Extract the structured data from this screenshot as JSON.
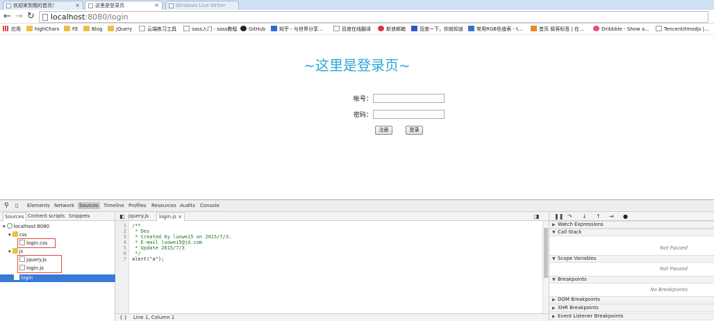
{
  "browser": {
    "tabs": [
      {
        "label": "欢迎来到我的首页！"
      },
      {
        "label": "这里是登录页"
      },
      {
        "label": "Windows Live Writer"
      }
    ],
    "url_host": "localhost",
    "url_rest": ":8080/login",
    "bookmarks": [
      {
        "label": "应用"
      },
      {
        "label": "highChars"
      },
      {
        "label": "FE"
      },
      {
        "label": "Blog"
      },
      {
        "label": "jQuery"
      },
      {
        "label": "云端练习工具"
      },
      {
        "label": "sass入门 - sass教程"
      },
      {
        "label": "GitHub"
      },
      {
        "label": "知乎 - 与世界分享..."
      },
      {
        "label": "百度在线翻译"
      },
      {
        "label": "新浪邮箱"
      },
      {
        "label": "百度一下，你就知道"
      },
      {
        "label": "常用RGB色值表 - t..."
      },
      {
        "label": "首页 极客标签 | 在..."
      },
      {
        "label": "Dribbble - Show a..."
      },
      {
        "label": "Tencent/tmodjs |..."
      }
    ]
  },
  "page": {
    "title": "~这里是登录页~",
    "account_label": "帐号：",
    "password_label": "密码：",
    "register_button": "注册",
    "login_button": "登录"
  },
  "devtools": {
    "tabs": [
      "Elements",
      "Network",
      "Sources",
      "Timeline",
      "Profiles",
      "Resources",
      "Audits",
      "Console"
    ],
    "navigator_tabs": [
      "Sources",
      "Content scripts",
      "Snippets"
    ],
    "tree": {
      "host": "localhost:8080",
      "css_folder": "css",
      "css_file": "login.css",
      "js_folder": "js",
      "js_files": [
        "jquery.js",
        "login.js"
      ],
      "selected": "login"
    },
    "editor_tabs": [
      "jquery.js",
      "login.js"
    ],
    "code_lines": [
      {
        "n": "1",
        "text": "/**"
      },
      {
        "n": "2",
        "text": " * Des"
      },
      {
        "n": "3",
        "text": " * Created by luowei5 on 2015/7/3."
      },
      {
        "n": "4",
        "text": " * E-mail luowei5@jd.com"
      },
      {
        "n": "5",
        "text": " * Update 2015/7/3"
      },
      {
        "n": "6",
        "text": " */"
      },
      {
        "n": "7",
        "text": "alert(\"a\");"
      }
    ],
    "status": "Line 1, Column 1",
    "sections": {
      "watch": "Watch Expressions",
      "call_stack": "Call Stack",
      "call_stack_empty": "Not Paused",
      "scope": "Scope Variables",
      "scope_empty": "Not Paused",
      "breakpoints": "Breakpoints",
      "breakpoints_empty": "No Breakpoints",
      "dom": "DOM Breakpoints",
      "xhr": "XHR Breakpoints",
      "event": "Event Listener Breakpoints"
    }
  },
  "colors": {
    "title": "#2aa7d6",
    "selection": "#3879d9",
    "highlight_box": "#e0453a"
  }
}
